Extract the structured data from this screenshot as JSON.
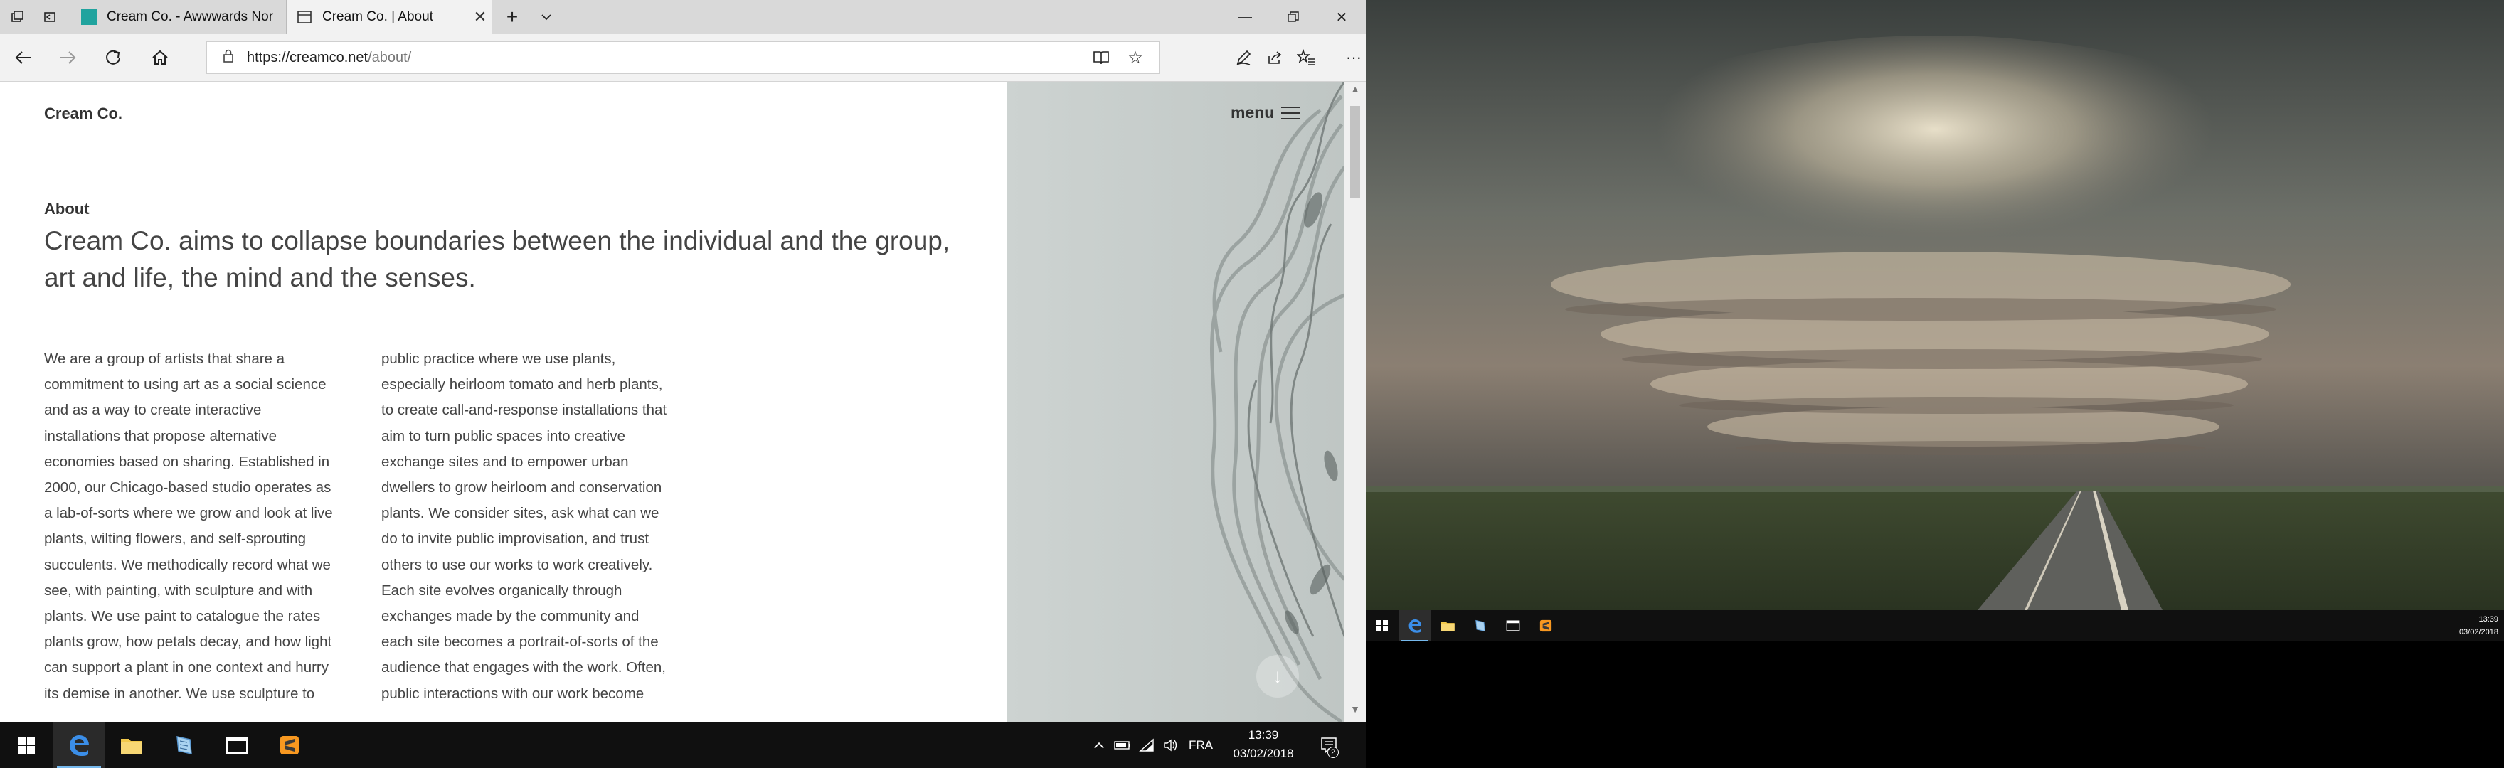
{
  "browser": {
    "tabs": [
      {
        "title": "Cream Co. - Awwwards Nor",
        "active": false
      },
      {
        "title": "Cream Co. | About",
        "active": true
      }
    ],
    "address": {
      "domain": "https://creamco.net",
      "path": "/about/"
    }
  },
  "page": {
    "brand": "Cream Co.",
    "menu_label": "menu",
    "section_label": "About",
    "lead": "Cream Co. aims to collapse boundaries between the individual and the group, art and life, the mind and the senses.",
    "col1": "We are a group of artists that share a commitment to using art as a social science and as a way to create interactive installations that propose alternative economies based on sharing. Established in 2000, our Chicago-based studio operates as a lab-of-sorts where we grow and look at live plants, wilting flowers, and self-sprouting succulents. We methodically record what we see, with painting, with sculpture and with plants. We use paint to catalogue the rates plants grow, how petals decay, and how light can support a plant in one context and hurry its demise in another. We use sculpture to",
    "col2": "public practice where we use plants, especially heirloom tomato and herb plants, to create call-and-response installations that aim to turn public spaces into creative exchange sites and to empower urban dwellers to grow heirloom and conservation plants. We consider sites, ask what can we do to invite public improvisation, and trust others to use our works to work creatively. Each site evolves organically through exchanges made by the community and each site becomes a portrait-of-sorts of the audience that engages with the work. Often, public interactions with our work become"
  },
  "taskbar": {
    "language": "FRA",
    "time": "13:39",
    "date": "03/02/2018",
    "notification_count": "2"
  },
  "desktop2": {
    "time": "13:39",
    "date": "03/02/2018"
  },
  "colors": {
    "accent": "#76b9ed",
    "taskbar": "#101010",
    "tab_active": "#f2f2f2",
    "art_panel": "#c9cfcd"
  }
}
